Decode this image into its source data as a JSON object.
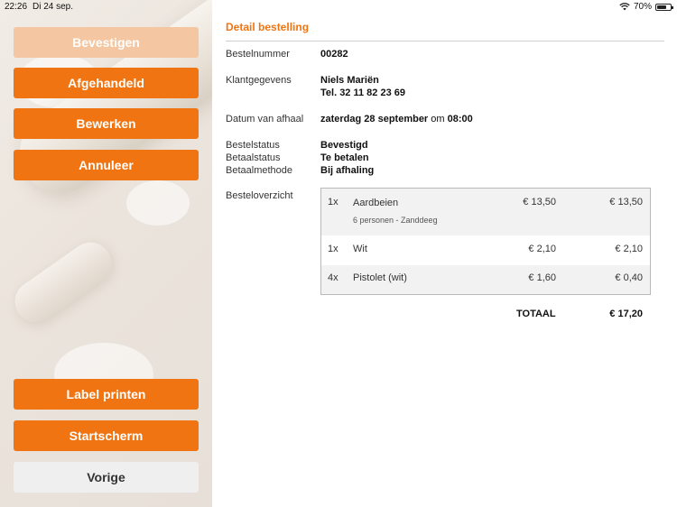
{
  "statusbar": {
    "time": "22:26",
    "date": "Di 24 sep.",
    "battery": "70%",
    "battery_level": 0.7
  },
  "sidebar": {
    "buttons": {
      "confirm": "Bevestigen",
      "handled": "Afgehandeld",
      "edit": "Bewerken",
      "cancel": "Annuleer",
      "print_label": "Label printen",
      "home": "Startscherm",
      "previous": "Vorige"
    }
  },
  "detail": {
    "title": "Detail bestelling",
    "order_number_label": "Bestelnummer",
    "order_number": "00282",
    "customer_label": "Klantgegevens",
    "customer_name": "Niels Mariën",
    "customer_phone": "Tel. 32 11 82 23 69",
    "pickup_label": "Datum van afhaal",
    "pickup_date": "zaterdag 28 september",
    "pickup_at": "om",
    "pickup_time": "08:00",
    "status_label": "Bestelstatus",
    "status_value": "Bevestigd",
    "payment_status_label": "Betaalstatus",
    "payment_status_value": "Te betalen",
    "payment_method_label": "Betaalmethode",
    "payment_method_value": "Bij afhaling",
    "overview_label": "Besteloverzicht",
    "items": [
      {
        "qty": "1x",
        "name": "Aardbeien",
        "note": "6 personen - Zanddeeg",
        "price": "€ 13,50",
        "total": "€ 13,50"
      },
      {
        "qty": "1x",
        "name": "Wit",
        "price": "€ 2,10",
        "total": "€ 2,10"
      },
      {
        "qty": "4x",
        "name": "Pistolet (wit)",
        "price": "€ 1,60",
        "total": "€ 0,40"
      }
    ],
    "total_label": "TOTAAL",
    "total_value": "€ 17,20"
  },
  "colors": {
    "accent": "#f07512",
    "accent_faded": "#f4c6a1"
  }
}
